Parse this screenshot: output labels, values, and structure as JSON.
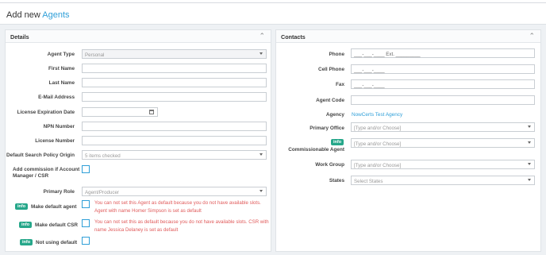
{
  "page": {
    "title_prefix": "Add new",
    "title_accent": "Agents"
  },
  "details": {
    "title": "Details",
    "agent_type": {
      "label": "Agent Type",
      "value": "Personal"
    },
    "first_name": {
      "label": "First Name",
      "value": ""
    },
    "last_name": {
      "label": "Last Name",
      "value": ""
    },
    "email": {
      "label": "E-Mail Address",
      "value": ""
    },
    "license_expiration": {
      "label": "License Expiration Date",
      "value": ""
    },
    "npn": {
      "label": "NPN Number",
      "value": ""
    },
    "license_number": {
      "label": "License Number",
      "value": ""
    },
    "search_policy": {
      "label": "Default Search Policy Origin",
      "value": "5 items checked"
    },
    "add_commission": {
      "label": "Add commission if Account Manager / CSR"
    },
    "primary_role": {
      "label": "Primary Role",
      "value": "Agent/Producer"
    },
    "make_default_agent": {
      "badge": "info",
      "label": "Make default agent",
      "warning": "You can not set this Agent as default because you do not have available slots. Agent with name Homer Simpson is set as default"
    },
    "make_default_csr": {
      "badge": "info",
      "label": "Make default CSR",
      "warning": "You can not set this as default because you do not have available slots. CSR with name Jessica Delaney is set as default"
    },
    "not_using_default": {
      "badge": "info",
      "label": "Not using default"
    }
  },
  "contacts": {
    "title": "Contacts",
    "phone": {
      "label": "Phone",
      "value": "___-___-____ Ext. _________"
    },
    "cell_phone": {
      "label": "Cell Phone",
      "value": "___-___-____"
    },
    "fax": {
      "label": "Fax",
      "value": "___-___-____"
    },
    "agent_code": {
      "label": "Agent Code",
      "value": ""
    },
    "agency": {
      "label": "Agency",
      "value": "NowCerts Test Agency"
    },
    "primary_office": {
      "label": "Primary Office",
      "placeholder": "[Type and/or Choose]"
    },
    "commissionable_agent": {
      "badge": "info",
      "label": "Commissionable Agent",
      "placeholder": "[Type and/or Choose]"
    },
    "work_group": {
      "label": "Work Group",
      "placeholder": "[Type and/or Choose]"
    },
    "states": {
      "label": "States",
      "placeholder": "Select States"
    }
  }
}
